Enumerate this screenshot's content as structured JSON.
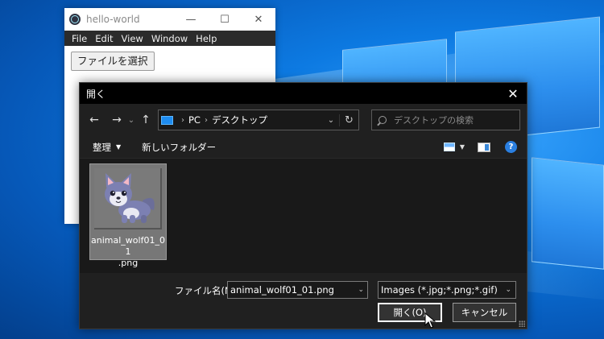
{
  "app_window": {
    "title": "hello-world",
    "menu": [
      "File",
      "Edit",
      "View",
      "Window",
      "Help"
    ],
    "select_file_button": "ファイルを選択"
  },
  "dialog": {
    "title": "開く",
    "breadcrumb": [
      "PC",
      "デスクトップ"
    ],
    "search_placeholder": "デスクトップの検索",
    "toolbar": {
      "organize": "整理",
      "new_folder": "新しいフォルダー"
    },
    "files": [
      {
        "name": "animal_wolf01_01.png",
        "name_line1": "animal_wolf01_01",
        "name_line2": ".png"
      }
    ],
    "footer": {
      "filename_label": "ファイル名(N):",
      "filename_value": "animal_wolf01_01.png",
      "filetype": "Images (*.jpg;*.png;*.gif)",
      "open_button": "開く(O)",
      "cancel_button": "キャンセル"
    }
  },
  "icons": {
    "app": "electron-atom-icon",
    "nav_back": "←",
    "nav_forward": "→",
    "nav_recent": "⌄",
    "nav_up": "↑",
    "refresh": "↻",
    "close": "✕",
    "minimize": "—",
    "maximize": "☐",
    "help": "?"
  },
  "colors": {
    "desktop_blue": "#0a6fd6",
    "dialog_bg": "#191919",
    "menubar_bg": "#2b2b2b"
  }
}
